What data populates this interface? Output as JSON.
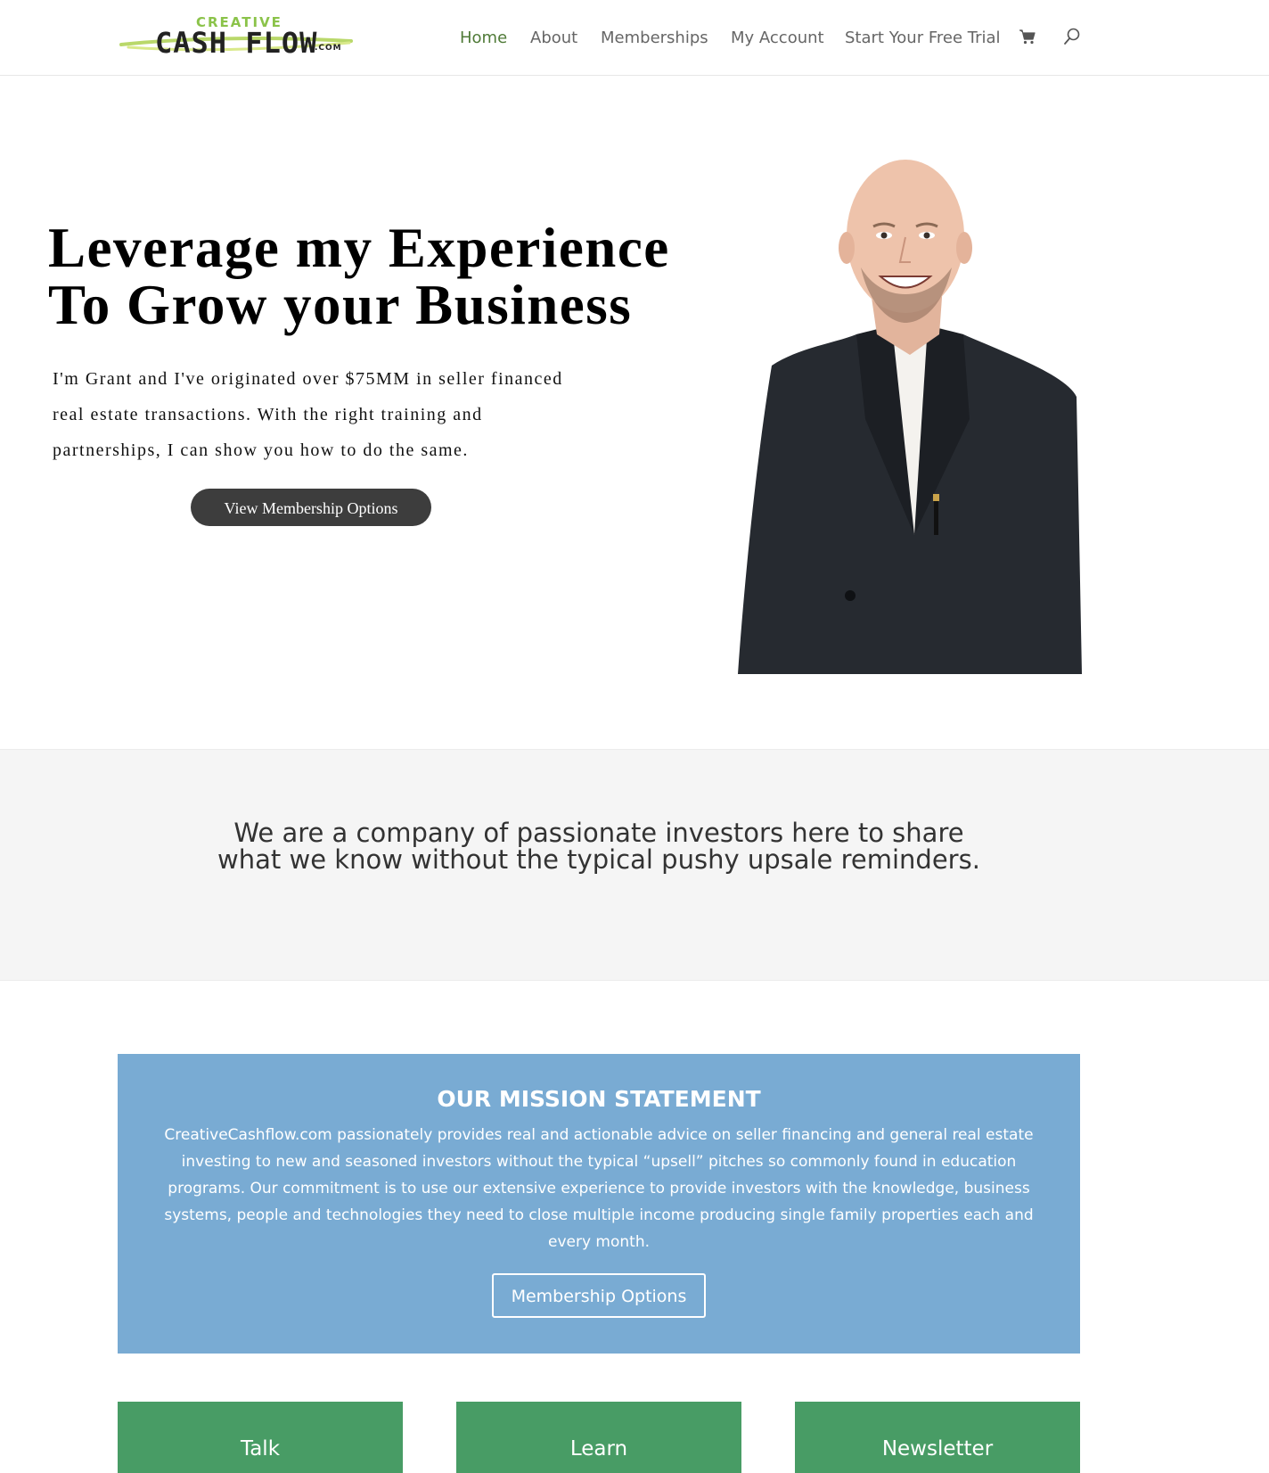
{
  "header": {
    "logo": {
      "top_word": "CREATIVE",
      "main_word": "CASH FLOW",
      "suffix": ".COM"
    },
    "nav": [
      {
        "label": "Home",
        "active": true
      },
      {
        "label": "About",
        "active": false
      },
      {
        "label": "Memberships",
        "active": false
      },
      {
        "label": "My Account",
        "active": false
      },
      {
        "label": "Start Your Free Trial",
        "active": false
      }
    ],
    "icons": [
      "cart-icon",
      "search-icon"
    ]
  },
  "hero": {
    "title_lines": [
      "Leverage my Experience",
      "To Grow your Business"
    ],
    "text_lines": [
      "I'm Grant and I've originated over $75MM in seller financed",
      "real estate transactions. With the right training and",
      "partnerships, I can show you how to do the same."
    ],
    "button_label": "View Membership Options"
  },
  "band": {
    "text_lines": [
      "We are a company of passionate investors here to share",
      "what we know without the typical pushy upsale reminders."
    ]
  },
  "mission": {
    "title": "OUR MISSION STATEMENT",
    "body_lines": [
      "CreativeCashflow.com passionately provides real and actionable advice on seller financing and general real estate",
      "investing to new and seasoned investors without the typical “upsell” pitches so commonly found in education",
      "programs. Our commitment is to use our extensive experience to provide investors with the knowledge, business",
      "systems,  people and technologies they need to close multiple income producing single family properties each and",
      "every month."
    ],
    "button_label": "Membership Options"
  },
  "cards": [
    {
      "label": "Talk"
    },
    {
      "label": "Learn"
    },
    {
      "label": "Newsletter"
    }
  ],
  "colors": {
    "nav_active": "#4f7a37",
    "nav_text": "#666666",
    "hero_button": "#3d3d3d",
    "band_background": "#f5f5f5",
    "mission_background": "#79abd3",
    "card_background": "#489c65",
    "logo_green": "#8bc34a"
  }
}
